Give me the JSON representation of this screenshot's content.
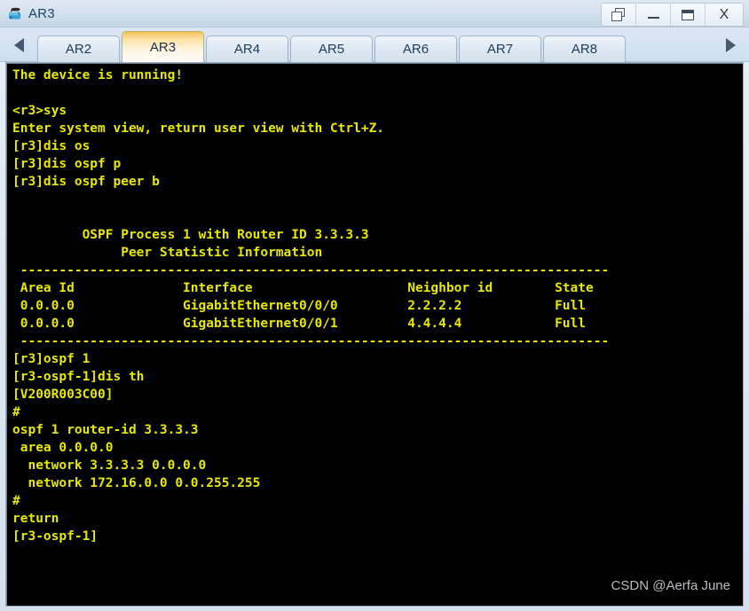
{
  "window": {
    "title": "AR3",
    "icon": "router-device-icon",
    "controls": [
      {
        "name": "restore-button",
        "label": "",
        "icon": "restore-icon"
      },
      {
        "name": "minimize-button",
        "label": "",
        "icon": "minimize-icon"
      },
      {
        "name": "maximize-button",
        "label": "",
        "icon": "maximize-icon"
      },
      {
        "name": "close-button",
        "label": "X",
        "icon": "close-icon"
      }
    ]
  },
  "tabbar": {
    "scroll_left_icon": "chevron-left-icon",
    "scroll_right_icon": "chevron-right-icon",
    "active_tab": "AR3",
    "tabs": [
      {
        "label": "AR2"
      },
      {
        "label": "AR3"
      },
      {
        "label": "AR4"
      },
      {
        "label": "AR5"
      },
      {
        "label": "AR6"
      },
      {
        "label": "AR7"
      },
      {
        "label": "AR8"
      }
    ]
  },
  "terminal": {
    "background": "#000000",
    "foreground": "#e8e800",
    "lines": [
      "The device is running!",
      "",
      "<r3>sys",
      "Enter system view, return user view with Ctrl+Z.",
      "[r3]dis os",
      "[r3]dis ospf p",
      "[r3]dis ospf peer b",
      "",
      "",
      "         OSPF Process 1 with Router ID 3.3.3.3",
      "              Peer Statistic Information",
      " ----------------------------------------------------------------------------",
      " Area Id              Interface                    Neighbor id        State",
      " 0.0.0.0              GigabitEthernet0/0/0         2.2.2.2            Full",
      " 0.0.0.0              GigabitEthernet0/0/1         4.4.4.4            Full",
      " ----------------------------------------------------------------------------",
      "[r3]ospf 1",
      "[r3-ospf-1]dis th",
      "[V200R003C00]",
      "#",
      "ospf 1 router-id 3.3.3.3",
      " area 0.0.0.0",
      "  network 3.3.3.3 0.0.0.0",
      "  network 172.16.0.0 0.0.255.255",
      "#",
      "return",
      "[r3-ospf-1]"
    ]
  },
  "watermark": {
    "text": "CSDN @Aerfa June"
  }
}
